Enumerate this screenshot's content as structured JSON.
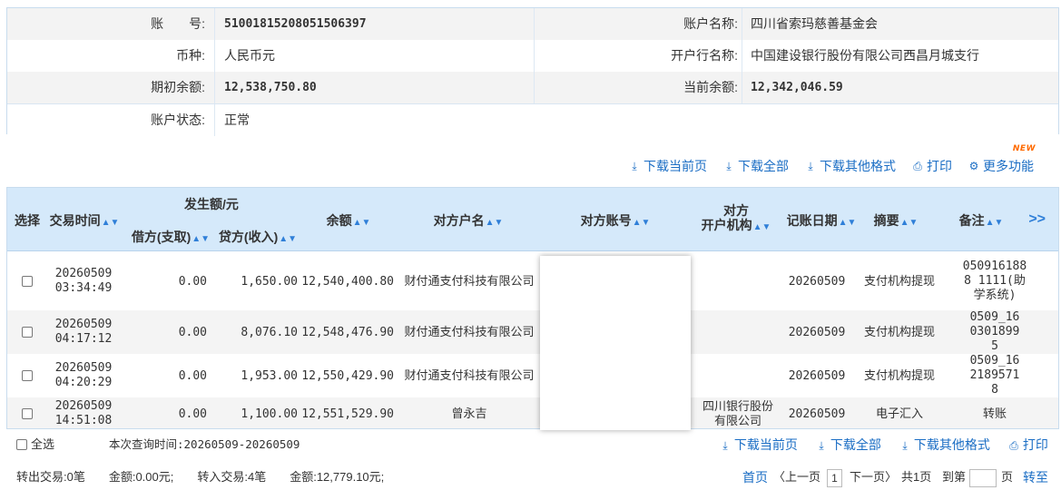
{
  "account": {
    "account_no_label": "账　　号:",
    "account_no": "51001815208051506397",
    "account_name_label": "账户名称:",
    "account_name": "四川省索玛慈善基金会",
    "currency_label": "币种:",
    "currency": "人民币元",
    "bank_label": "开户行名称:",
    "bank": "中国建设银行股份有限公司西昌月城支行",
    "opening_balance_label": "期初余额:",
    "opening_balance": "12,538,750.80",
    "current_balance_label": "当前余额:",
    "current_balance": "12,342,046.59",
    "status_label": "账户状态:",
    "status": "正常"
  },
  "toolbar": {
    "download_page": "下载当前页",
    "download_all": "下载全部",
    "download_other": "下载其他格式",
    "print": "打印",
    "more": "更多功能",
    "new_badge": "NEW"
  },
  "table": {
    "headers": {
      "select": "选择",
      "time": "交易时间",
      "amount_group": "发生额/元",
      "debit": "借方(支取)",
      "credit": "贷方(收入)",
      "balance": "余额",
      "counterparty_name": "对方户名",
      "counterparty_account": "对方账号",
      "counterparty_bank_1": "对方",
      "counterparty_bank_2": "开户机构",
      "post_date": "记账日期",
      "summary": "摘要",
      "remark": "备注"
    },
    "rows": [
      {
        "date": "20260509",
        "time": "03:34:49",
        "debit": "0.00",
        "credit": "1,650.00",
        "balance": "12,540,400.80",
        "name": "财付通支付科技有限公司",
        "bank": "",
        "post_date": "20260509",
        "summary": "支付机构提现",
        "remark": "0509161888 1111(助学系统)"
      },
      {
        "date": "20260509",
        "time": "04:17:12",
        "debit": "0.00",
        "credit": "8,076.10",
        "balance": "12,548,476.90",
        "name": "财付通支付科技有限公司",
        "bank": "",
        "post_date": "20260509",
        "summary": "支付机构提现",
        "remark": "0509_1603018995"
      },
      {
        "date": "20260509",
        "time": "04:20:29",
        "debit": "0.00",
        "credit": "1,953.00",
        "balance": "12,550,429.90",
        "name": "财付通支付科技有限公司",
        "bank": "",
        "post_date": "20260509",
        "summary": "支付机构提现",
        "remark": "0509_1621895718"
      },
      {
        "date": "20260509",
        "time": "14:51:08",
        "debit": "0.00",
        "credit": "1,100.00",
        "balance": "12,551,529.90",
        "name": "曾永吉",
        "bank": "四川银行股份有限公司",
        "post_date": "20260509",
        "summary": "电子汇入",
        "remark": "转账"
      }
    ]
  },
  "footer": {
    "select_all": "全选",
    "query_time": "本次查询时间:20260509-20260509",
    "download_page": "下载当前页",
    "download_all": "下载全部",
    "download_other": "下载其他格式",
    "print": "打印",
    "summary": "转出交易:0笔　　金额:0.00元;　　转入交易:4笔　　金额:12,779.10元;",
    "first": "首页",
    "prev": "〈上一页",
    "page": "1",
    "next": "下一页〉",
    "total_pages": "共1页",
    "goto_label": "到第",
    "page_suffix": "页",
    "goto": "转至"
  }
}
